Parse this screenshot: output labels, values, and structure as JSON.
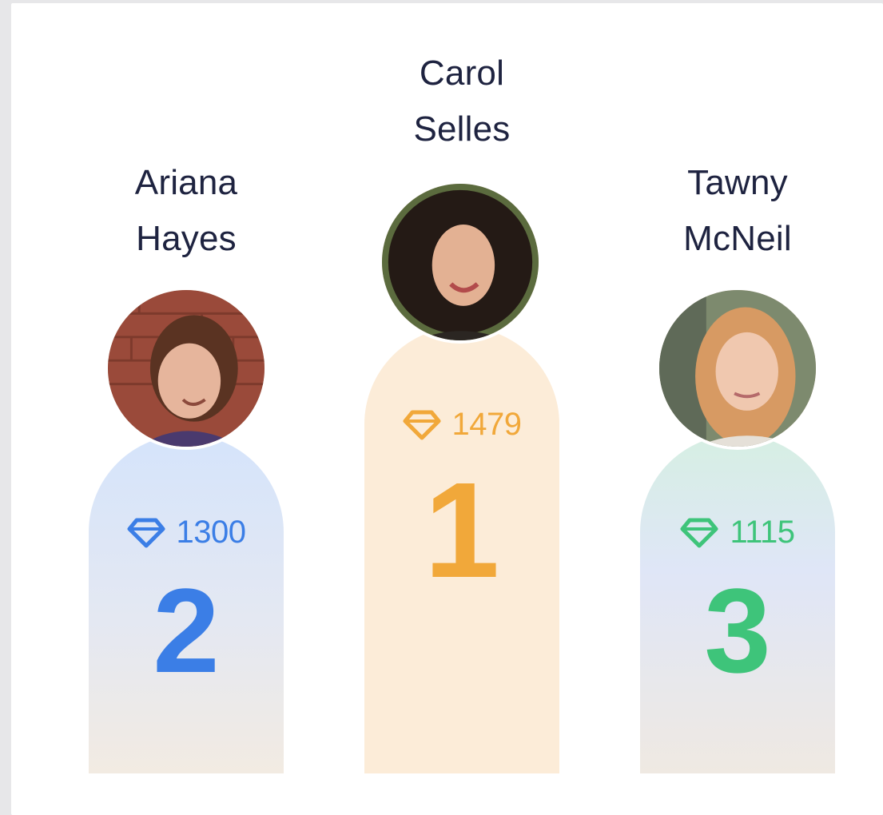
{
  "leaderboard": {
    "second": {
      "first_name": "Ariana",
      "last_name": "Hayes",
      "score": "1300",
      "rank": "2",
      "accent": "#3b7ee6"
    },
    "first": {
      "first_name": "Carol",
      "last_name": "Selles",
      "score": "1479",
      "rank": "1",
      "accent": "#f1a83a"
    },
    "third": {
      "first_name": "Tawny",
      "last_name": "McNeil",
      "score": "1115",
      "rank": "3",
      "accent": "#3ec47a"
    }
  },
  "icons": {
    "score": "gem-icon"
  }
}
